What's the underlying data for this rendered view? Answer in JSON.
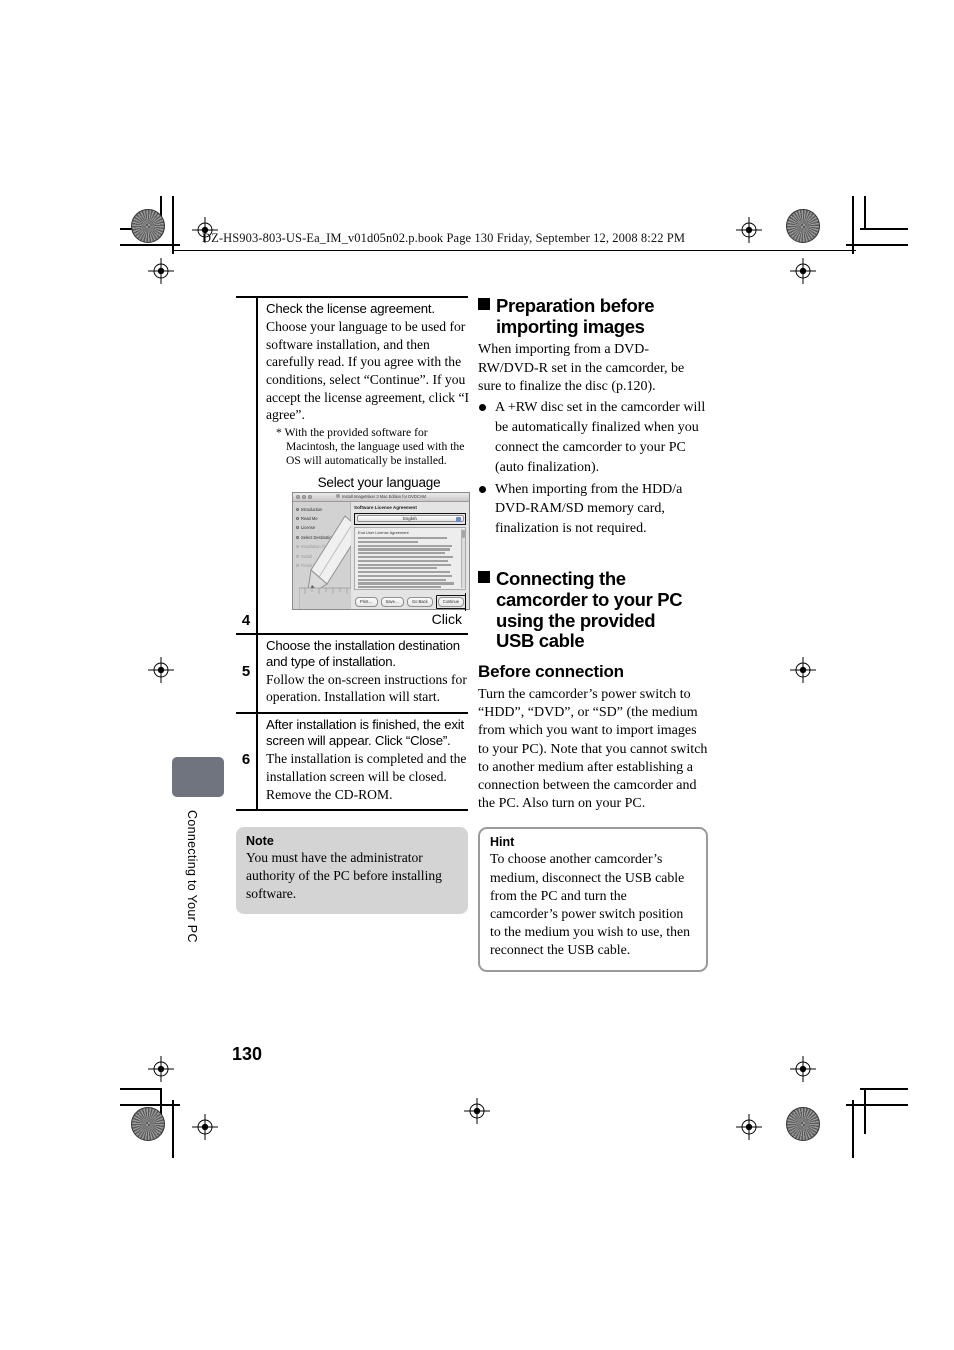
{
  "header": {
    "file_info": "DZ-HS903-803-US-Ea_IM_v01d05n02.p.book  Page 130  Friday, September 12, 2008  8:22 PM"
  },
  "side_tab": {
    "label": "Connecting to Your PC"
  },
  "page_number": "130",
  "left_column": {
    "steps": [
      {
        "number": "4",
        "title": "Check the license agreement.",
        "text": "Choose your language to be used for software installation, and then carefully read. If you agree with the conditions, select “Continue”. If you accept the license agreement, click “I agree”.",
        "footnote": "* With the provided software for Macintosh, the language used with the OS will automatically be installed."
      },
      {
        "number": "5",
        "title": "Choose the installation destination and type of installation.",
        "text": "Follow the on-screen instructions for operation. Installation will start."
      },
      {
        "number": "6",
        "title": "After installation is finished, the exit screen will appear. Click “Close”.",
        "text": "The installation is completed and the installation screen will be closed. Remove the CD-ROM."
      }
    ],
    "figure": {
      "caption_top": "Select your language",
      "caption_bottom": "Click",
      "window_title": "Install ImageMixer 3 Mac Edition for DVDCAM",
      "pane_heading": "Software License Agreement",
      "language_value": "English",
      "eula_heading": "End User License Agreement",
      "sidebar_items": [
        {
          "label": "Introduction",
          "state": "done"
        },
        {
          "label": "Read Me",
          "state": "done"
        },
        {
          "label": "License",
          "state": "current"
        },
        {
          "label": "Select Destination",
          "state": "done"
        },
        {
          "label": "Installation Type",
          "state": "dim"
        },
        {
          "label": "Install",
          "state": "dim"
        },
        {
          "label": "Finish Up",
          "state": "dim"
        }
      ],
      "buttons": [
        "Print…",
        "Save…",
        "Go Back",
        "Continue"
      ]
    },
    "note": {
      "title": "Note",
      "text": "You must have the administrator authority of the PC before installing software."
    }
  },
  "right_column": {
    "section1": {
      "heading_line1": "Preparation before",
      "heading_line2": "importing images",
      "body": "When importing from a DVD-RW/DVD-R set in the camcorder, be sure to finalize the disc (p.120).",
      "bullets": [
        "A +RW disc set in the camcorder will be automatically finalized when you connect the camcorder to your PC (auto finalization).",
        "When importing from the HDD/a DVD-RAM/SD memory card, finalization is not required."
      ]
    },
    "section2": {
      "heading_line1": "Connecting the",
      "heading_line2": "camcorder to your PC",
      "heading_line3": "using the provided",
      "heading_line4": "USB cable",
      "subheading": "Before connection",
      "body": "Turn the camcorder’s power switch to “HDD”, “DVD”, or “SD” (the medium from which you want to import images to your PC). Note that you cannot switch to another medium after establishing a connection between the camcorder and the PC. Also turn on your PC."
    },
    "hint": {
      "title": "Hint",
      "text": "To choose another camcorder’s medium, disconnect the USB cable from the PC and turn the camcorder’s power switch position to the medium you wish to use, then reconnect the USB cable."
    }
  }
}
